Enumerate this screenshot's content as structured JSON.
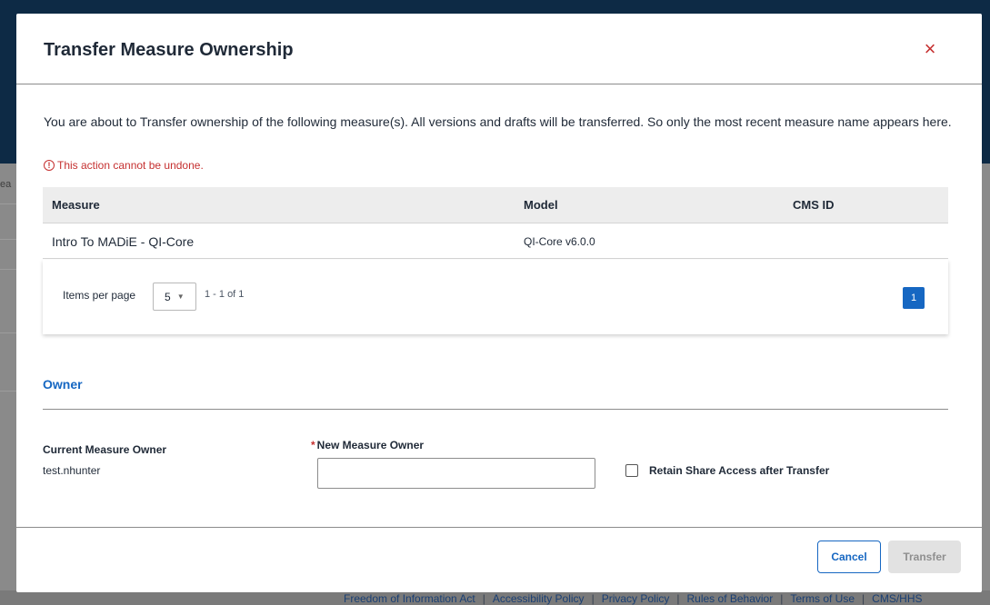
{
  "background": {
    "fragment": "ea",
    "footer_links": [
      "Freedom of Information Act",
      "Accessibility Policy",
      "Privacy Policy",
      "Rules of Behavior",
      "Terms of Use",
      "CMS/HHS"
    ],
    "separator": "|"
  },
  "modal": {
    "title": "Transfer Measure Ownership",
    "close_icon": "×",
    "description": "You are about to Transfer ownership of the following measure(s). All versions and drafts will be transferred. So only the most recent measure name appears here.",
    "warning": {
      "icon": "!",
      "text": "This action cannot be undone."
    },
    "table": {
      "headers": [
        "Measure",
        "Model",
        "CMS ID"
      ],
      "rows": [
        [
          "Intro To MADiE - QI-Core",
          "QI-Core v6.0.0",
          ""
        ]
      ]
    },
    "pagination": {
      "items_per_page_label": "Items per page",
      "items_per_page_value": "5",
      "caret": "▼",
      "range": "1 - 1 of 1",
      "current_page": "1"
    },
    "owner_section": {
      "title": "Owner",
      "current_owner_label": "Current Measure Owner",
      "current_owner_value": "test.nhunter",
      "required_marker": "*",
      "new_owner_label": "New Measure Owner",
      "new_owner_value": "",
      "retain_label": "Retain Share Access after Transfer"
    },
    "buttons": {
      "cancel": "Cancel",
      "transfer": "Transfer"
    }
  },
  "colors": {
    "accent": "#1667c2",
    "danger": "#c53030",
    "header_bg": "#0d2a45",
    "disabled_bg": "#e2e2e2"
  }
}
